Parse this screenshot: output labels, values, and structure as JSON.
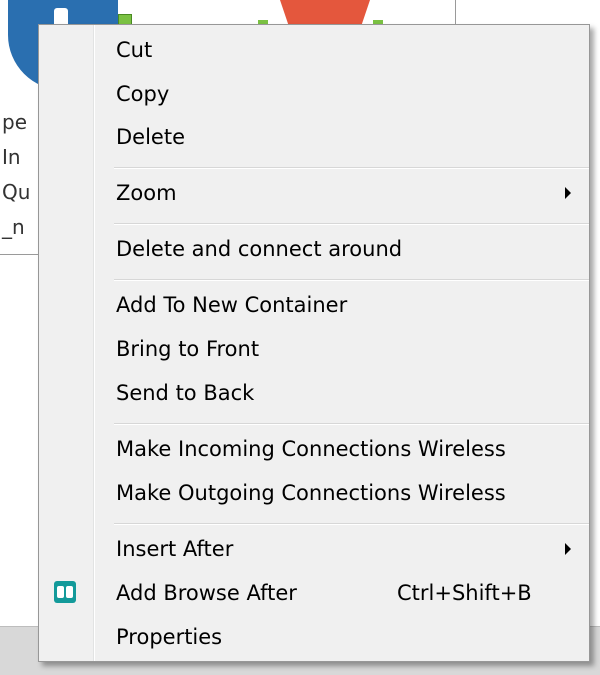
{
  "menu": {
    "items": [
      {
        "label": "Cut"
      },
      {
        "label": "Copy"
      },
      {
        "label": "Delete"
      },
      {
        "label": "Zoom"
      },
      {
        "label": "Delete and connect around"
      },
      {
        "label": "Add To New Container"
      },
      {
        "label": "Bring to Front"
      },
      {
        "label": "Send to Back"
      },
      {
        "label": "Make Incoming Connections Wireless"
      },
      {
        "label": "Make Outgoing Connections Wireless"
      },
      {
        "label": "Insert After"
      },
      {
        "label": "Add Browse After",
        "shortcut": "Ctrl+Shift+B",
        "icon": "binoculars-icon"
      },
      {
        "label": "Properties"
      }
    ]
  },
  "background": {
    "panel_fragments": [
      "pe",
      "In",
      "Qu",
      "_n"
    ]
  },
  "colors": {
    "menu_bg": "#f0f0f0",
    "icon_teal": "#139a9a",
    "tool_blue": "#2a6fb0",
    "tool_red": "#e4573d",
    "tool_green": "#7ac142"
  }
}
